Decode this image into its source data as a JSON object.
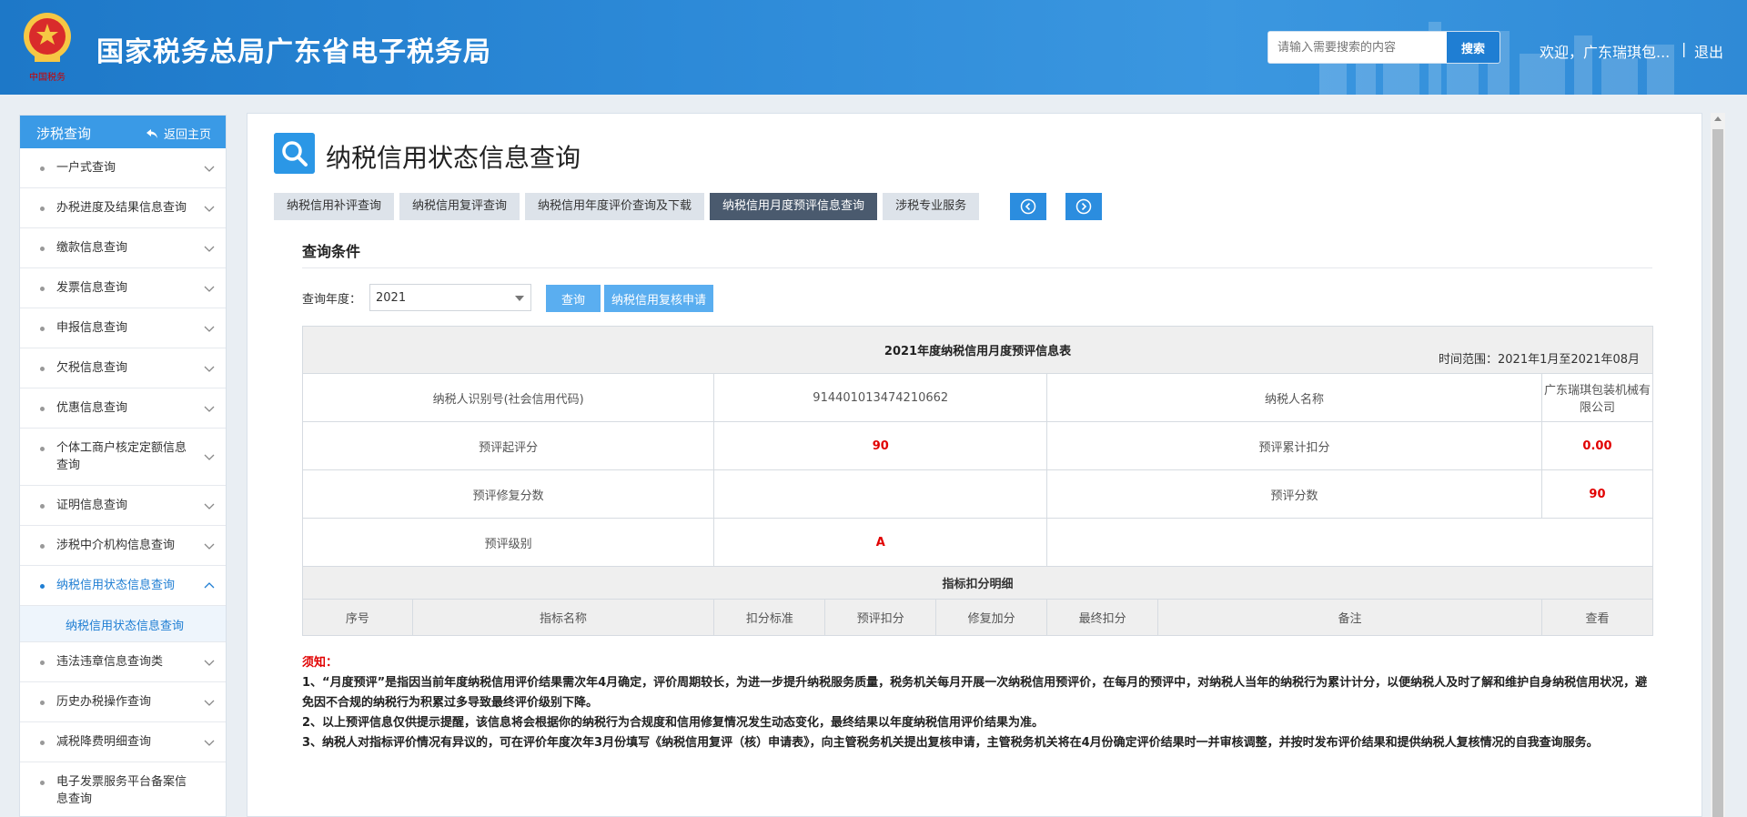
{
  "header": {
    "title": "国家税务总局广东省电子税务局",
    "search_placeholder": "请输入需要搜索的内容",
    "search_button": "搜索",
    "welcome": "欢迎，广东瑞琪包...",
    "separator": "|",
    "logout": "退出"
  },
  "sidebar": {
    "title": "涉税查询",
    "home": "返回主页",
    "items": [
      {
        "label": "一户式查询"
      },
      {
        "label": "办税进度及结果信息查询"
      },
      {
        "label": "缴款信息查询"
      },
      {
        "label": "发票信息查询"
      },
      {
        "label": "申报信息查询"
      },
      {
        "label": "欠税信息查询"
      },
      {
        "label": "优惠信息查询"
      },
      {
        "label": "个体工商户核定定额信息查询"
      },
      {
        "label": "证明信息查询"
      },
      {
        "label": "涉税中介机构信息查询"
      },
      {
        "label": "纳税信用状态信息查询"
      },
      {
        "label": "违法违章信息查询类"
      },
      {
        "label": "历史办税操作查询"
      },
      {
        "label": "减税降费明细查询"
      },
      {
        "label": "电子发票服务平台备案信息查询"
      }
    ],
    "sub_item": "纳税信用状态信息查询"
  },
  "page": {
    "title": "纳税信用状态信息查询",
    "tabs": [
      {
        "label": "纳税信用补评查询"
      },
      {
        "label": "纳税信用复评查询"
      },
      {
        "label": "纳税信用年度评价查询及下载"
      },
      {
        "label": "纳税信用月度预评信息查询"
      },
      {
        "label": "涉税专业服务"
      }
    ],
    "section_title": "查询条件",
    "query_label": "查询年度：",
    "year_value": "2021",
    "query_button": "查询",
    "review_button": "纳税信用复核申请"
  },
  "table": {
    "caption": "2021年度纳税信用月度预评信息表",
    "range": "时间范围：2021年1月至2021年08月",
    "taxpayer_id_label": "纳税人识别号(社会信用代码)",
    "taxpayer_id": "914401013474210662",
    "taxpayer_name_label": "纳税人名称",
    "taxpayer_name": "广东瑞琪包装机械有限公司",
    "start_score_label": "预评起评分",
    "start_score": "90",
    "deduct_label": "预评累计扣分",
    "deduct": "0.00",
    "repair_label": "预评修复分数",
    "repair": "",
    "score_label": "预评分数",
    "score": "90",
    "level_label": "预评级别",
    "level": "A",
    "detail_title": "指标扣分明细",
    "columns": [
      "序号",
      "指标名称",
      "扣分标准",
      "预评扣分",
      "修复加分",
      "最终扣分",
      "备注",
      "查看"
    ]
  },
  "notes": {
    "title": "须知：",
    "lines": [
      "1、“月度预评”是指因当前年度纳税信用评价结果需次年4月确定，评价周期较长，为进一步提升纳税服务质量，税务机关每月开展一次纳税信用预评价，在每月的预评中，对纳税人当年的纳税行为累计计分，以便纳税人及时了解和维护自身纳税信用状况，避免因不合规的纳税行为积累过多导致最终评价级别下降。",
      "2、以上预评信息仅供提示提醒，该信息将会根据你的纳税行为合规度和信用修复情况发生动态变化，最终结果以年度纳税信用评价结果为准。",
      "3、纳税人对指标评价情况有异议的，可在评价年度次年3月份填写《纳税信用复评（核）申请表》，向主管税务机关提出复核申请，主管税务机关将在4月份确定评价结果时一并审核调整，并按时发布评价结果和提供纳税人复核情况的自我查询服务。"
    ]
  },
  "colors": {
    "brand_blue": "#2b8ddf",
    "active_tab": "#4a5a6e",
    "alert_red": "#e10000"
  },
  "icons": {
    "logo": "tax-emblem-icon",
    "home": "back-arrow-icon",
    "page": "search-magnifier-icon"
  }
}
